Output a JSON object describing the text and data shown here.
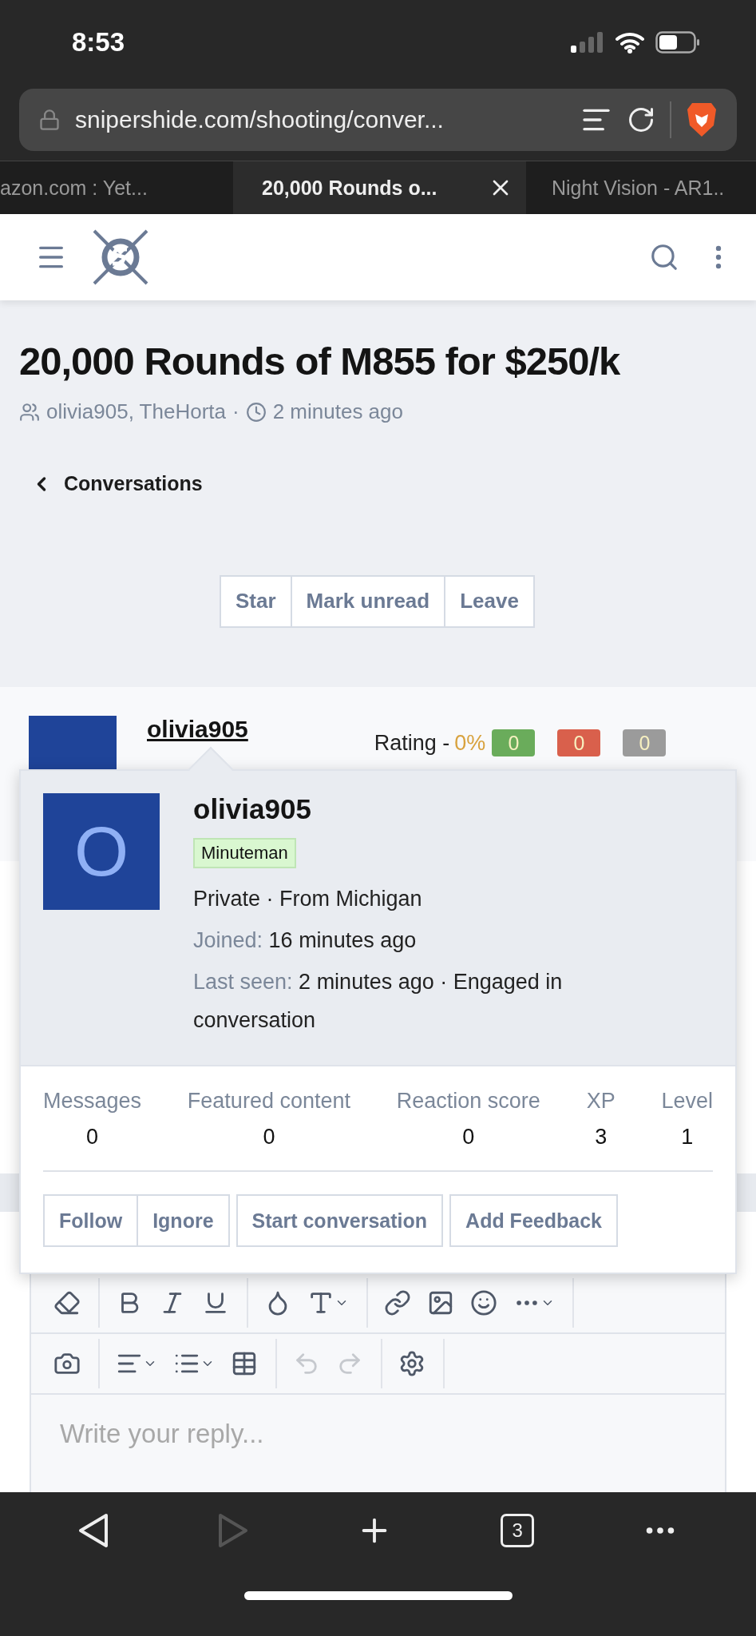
{
  "status_bar": {
    "time": "8:53"
  },
  "browser": {
    "url": "snipershide.com/shooting/conver...",
    "tabs": [
      {
        "title": "azon.com : Yet...",
        "selected": false
      },
      {
        "title": "20,000 Rounds o...",
        "selected": true
      },
      {
        "title": "Night Vision - AR1..",
        "selected": false
      }
    ]
  },
  "conversation": {
    "title": "20,000 Rounds of M855 for $250/k",
    "participants": "olivia905, TheHorta",
    "separator": "·",
    "time": "2 minutes ago",
    "back_link": "Conversations",
    "actions": [
      "Star",
      "Mark unread",
      "Leave"
    ]
  },
  "message": {
    "author": "olivia905",
    "rating_label": "Rating -",
    "rating_percent": "0%",
    "feedback_counts": [
      {
        "value": "0",
        "color": "#6aac5b"
      },
      {
        "value": "0",
        "color": "#d9604c"
      },
      {
        "value": "0",
        "color": "#9b9b9b"
      }
    ]
  },
  "member_card": {
    "avatar_letter": "O",
    "name": "olivia905",
    "banner": "Minuteman",
    "info": "Private · From Michigan",
    "joined_label": "Joined:",
    "joined": "16 minutes ago",
    "last_seen_label": "Last seen:",
    "last_seen": "2 minutes ago · Engaged in conversation",
    "stats": [
      {
        "label": "Messages",
        "value": "0"
      },
      {
        "label": "Featured content",
        "value": "0"
      },
      {
        "label": "Reaction score",
        "value": "0"
      },
      {
        "label": "XP",
        "value": "3"
      },
      {
        "label": "Level",
        "value": "1"
      }
    ],
    "button_groups": [
      [
        "Follow",
        "Ignore"
      ],
      [
        "Start conversation"
      ],
      [
        "Add Feedback"
      ]
    ]
  },
  "editor": {
    "toolbar": [
      [
        [
          {
            "kind": "eraser",
            "disabled": false
          }
        ],
        [
          {
            "kind": "bold",
            "disabled": false
          },
          {
            "kind": "italic",
            "disabled": false
          },
          {
            "kind": "underline",
            "disabled": false
          }
        ],
        [
          {
            "kind": "color",
            "disabled": false
          },
          {
            "kind": "font-size",
            "disabled": false
          }
        ],
        [
          {
            "kind": "link",
            "disabled": false
          },
          {
            "kind": "image",
            "disabled": false
          },
          {
            "kind": "smilie",
            "disabled": false
          },
          {
            "kind": "more",
            "disabled": false
          }
        ]
      ],
      [
        [
          {
            "kind": "camera",
            "disabled": false
          }
        ],
        [
          {
            "kind": "align",
            "disabled": false
          },
          {
            "kind": "list",
            "disabled": false
          },
          {
            "kind": "table",
            "disabled": false
          }
        ],
        [
          {
            "kind": "undo",
            "disabled": true
          },
          {
            "kind": "redo",
            "disabled": true
          }
        ],
        [
          {
            "kind": "settings",
            "disabled": false
          }
        ]
      ]
    ],
    "placeholder": "Write your reply..."
  },
  "bottom_bar": {
    "back_disabled": false,
    "forward_disabled": true,
    "tab_count": "3"
  }
}
